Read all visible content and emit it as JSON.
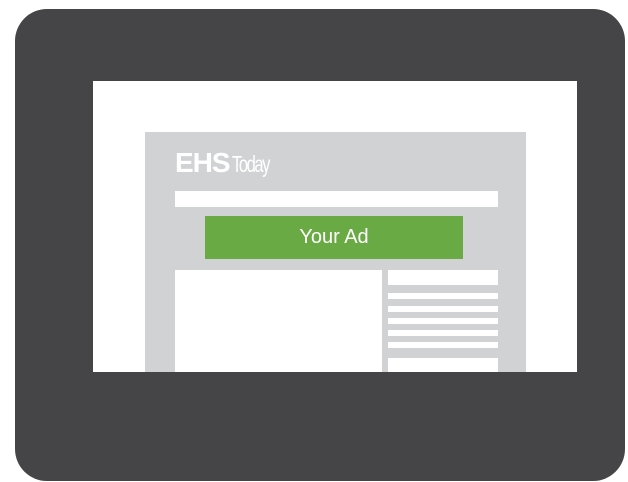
{
  "logo": {
    "bold_text": "EHS",
    "light_text": "Today"
  },
  "ad": {
    "label": "Your Ad",
    "color": "#6aaa44"
  },
  "colors": {
    "frame": "#454547",
    "screen": "#ffffff",
    "page": "#d1d2d4"
  }
}
